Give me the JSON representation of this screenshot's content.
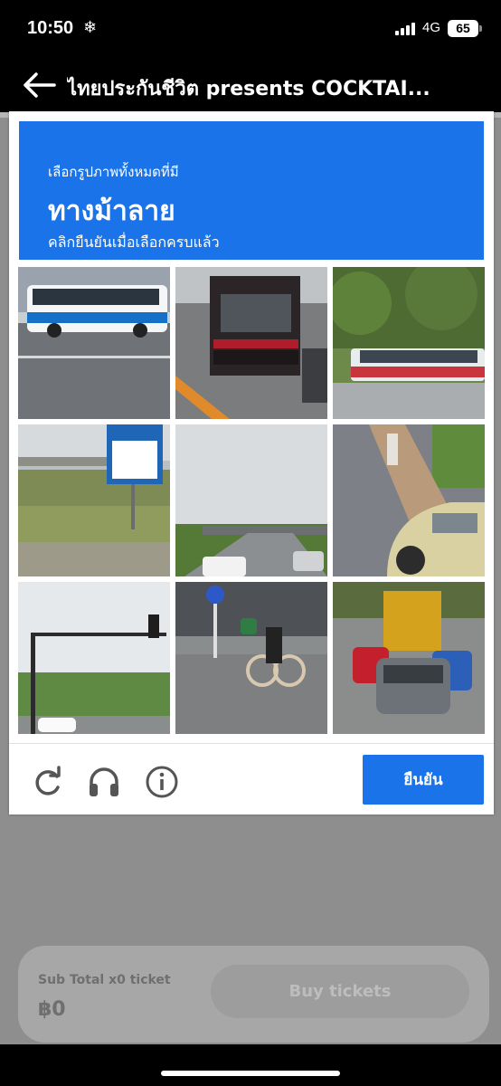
{
  "status_bar": {
    "time": "10:50",
    "network": "4G",
    "battery": "65"
  },
  "header": {
    "title": "ไทยประกันชีวิต presents COCKTAI..."
  },
  "captcha": {
    "instruction": "เลือกรูปภาพทั้งหมดที่มี",
    "target": "ทางม้าลาย",
    "hint": "คลิกยืนยันเมื่อเลือกครบแล้ว",
    "verify_label": "ยืนยัน",
    "tiles": [
      {
        "icon": "bus-image"
      },
      {
        "icon": "truck-image"
      },
      {
        "icon": "tram-image"
      },
      {
        "icon": "road-sign-image"
      },
      {
        "icon": "overpass-image"
      },
      {
        "icon": "cyclist-car-image"
      },
      {
        "icon": "traffic-light-image"
      },
      {
        "icon": "bicycle-image"
      },
      {
        "icon": "traffic-cars-image"
      }
    ],
    "colors": {
      "accent": "#1a73e8"
    }
  },
  "purchase": {
    "subtotal_label": "Sub Total x0 ticket",
    "price": "฿0",
    "buy_label": "Buy tickets"
  }
}
